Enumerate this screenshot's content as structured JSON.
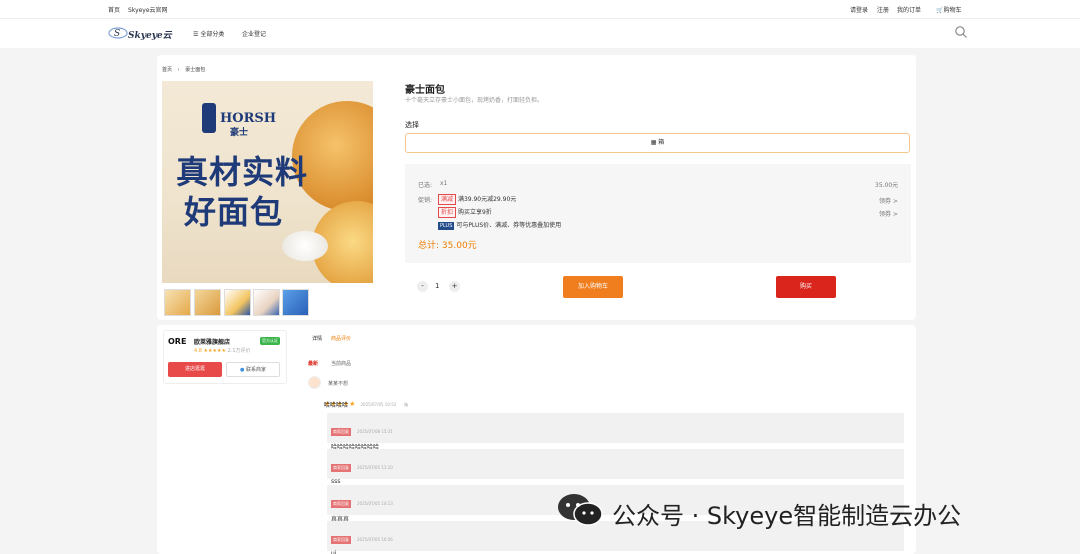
{
  "topbar": {
    "home": "首页",
    "site": "Skyeye云官网",
    "login": "请登录",
    "register": "注册",
    "orders": "我的订单",
    "cart": "购物车",
    "cart_icon": "cart-icon"
  },
  "nav": {
    "logo_text": "Skyeye云",
    "all_categories": "全部分类",
    "enterprise": "企业登记",
    "search_icon": "search-icon"
  },
  "breadcrumb": {
    "home": "首页",
    "separator": "›",
    "current": "豪士面包"
  },
  "product_image": {
    "brand": "HORSH",
    "brand_cn": "豪士",
    "line1": "真材实料",
    "line2": "好面包"
  },
  "product": {
    "title": "豪士面包",
    "subtitle": "十个毫天立存豪士小面包，现烤奶香，打面轻负担。",
    "select_label": "选择",
    "option": "箱",
    "selected_label": "已选:",
    "selected_value": "x1",
    "price": "35.00元",
    "promo_label": "促销:",
    "promos": [
      {
        "tag": "满减",
        "text": "满39.90元减29.90元",
        "action": "领券 >"
      },
      {
        "tag": "折扣",
        "text": "购买立享9折",
        "action": "领券 >"
      },
      {
        "tag": "PLUS",
        "text": "可与PLUS价、满减、券等优惠叠加使用",
        "action": ""
      }
    ],
    "total_label": "总计:",
    "total_value": "35.00元",
    "qty_minus": "-",
    "qty_value": "1",
    "qty_plus": "+",
    "add_to_cart": "加入购物车",
    "buy_now": "购买"
  },
  "shop": {
    "logo_text": "ORE",
    "name": "欧莱雅旗舰店",
    "badge": "官方认证",
    "rating_label": "4.8",
    "rating_sub": "2.1万评价",
    "enter_button": "进店逛逛",
    "follow_button": "联系商家"
  },
  "tabs": {
    "details": "详情",
    "reviews": "商品评价"
  },
  "review_filters": {
    "good": "最新",
    "all": "当前商品"
  },
  "review": {
    "username": "某某不想",
    "date": "2025/07/05 10:52",
    "extra": "· 箱",
    "text": "哈哈哈哈",
    "replies": [
      {
        "tag": "商家回复",
        "date": "2025/07/08 15:31",
        "text": "哈哈哈哈哈哈哈哈"
      },
      {
        "tag": "商家回复",
        "date": "2025/07/05 11:10",
        "text": "sss"
      },
      {
        "tag": "商家回复",
        "date": "2025/07/05 14:13",
        "text": "哀哀哀"
      },
      {
        "tag": "商家回复",
        "date": "2025/07/05 10:56",
        "text": "uj"
      }
    ]
  },
  "watermark": {
    "text": "公众号 · Skyeye智能制造云办公"
  }
}
